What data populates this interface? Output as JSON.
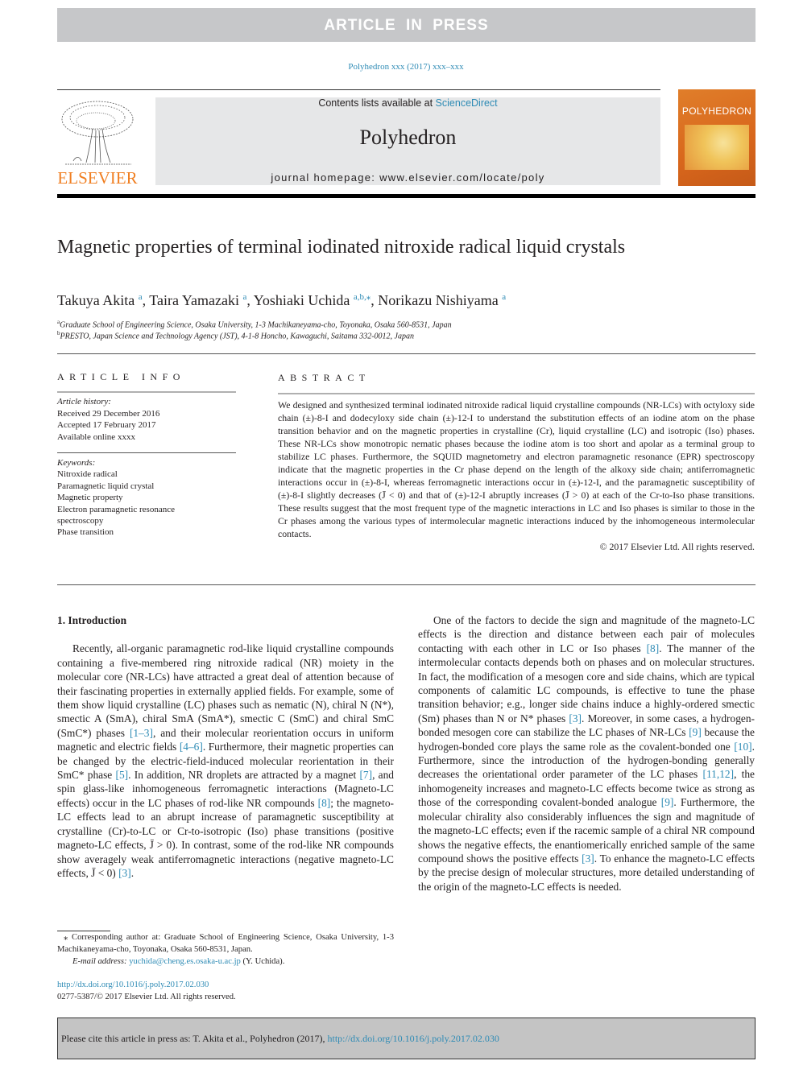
{
  "banner": "ARTICLE IN PRESS",
  "journal_ref": "Polyhedron xxx (2017) xxx–xxx",
  "header": {
    "publisher_logo_text": "ELSEVIER",
    "contents_prefix": "Contents lists available at ",
    "contents_link": "ScienceDirect",
    "journal_name": "Polyhedron",
    "homepage": "journal homepage: www.elsevier.com/locate/poly",
    "cover_title": "POLYHEDRON"
  },
  "article": {
    "title": "Magnetic properties of terminal iodinated nitroxide radical liquid crystals",
    "authors": [
      {
        "name": "Takuya Akita",
        "sup": "a"
      },
      {
        "name": "Taira Yamazaki",
        "sup": "a"
      },
      {
        "name": "Yoshiaki Uchida",
        "sup": "a,b,⁎"
      },
      {
        "name": "Norikazu Nishiyama",
        "sup": "a"
      }
    ],
    "affiliations": [
      {
        "sup": "a",
        "text": "Graduate School of Engineering Science, Osaka University, 1-3 Machikaneyama-cho, Toyonaka, Osaka 560-8531, Japan"
      },
      {
        "sup": "b",
        "text": "PRESTO, Japan Science and Technology Agency (JST), 4-1-8 Honcho, Kawaguchi, Saitama 332-0012, Japan"
      }
    ]
  },
  "article_info": {
    "heading": "ARTICLE INFO",
    "history_label": "Article history:",
    "history": [
      "Received 29 December 2016",
      "Accepted 17 February 2017",
      "Available online xxxx"
    ],
    "keywords_label": "Keywords:",
    "keywords": [
      "Nitroxide radical",
      "Paramagnetic liquid crystal",
      "Magnetic property",
      "Electron paramagnetic resonance",
      "spectroscopy",
      "Phase transition"
    ]
  },
  "abstract": {
    "heading": "ABSTRACT",
    "text": "We designed and synthesized terminal iodinated nitroxide radical liquid crystalline compounds (NR-LCs) with octyloxy side chain (±)-8-I and dodecyloxy side chain (±)-12-I to understand the substitution effects of an iodine atom on the phase transition behavior and on the magnetic properties in crystalline (Cr), liquid crystalline (LC) and isotropic (Iso) phases. These NR-LCs show monotropic nematic phases because the iodine atom is too short and apolar as a terminal group to stabilize LC phases. Furthermore, the SQUID magnetometry and electron paramagnetic resonance (EPR) spectroscopy indicate that the magnetic properties in the Cr phase depend on the length of the alkoxy side chain; antiferromagnetic interactions occur in (±)-8-I, whereas ferromagnetic interactions occur in (±)-12-I, and the paramagnetic susceptibility of (±)-8-I slightly decreases (J̄ < 0) and that of (±)-12-I abruptly increases (J̄ > 0) at each of the Cr-to-Iso phase transitions. These results suggest that the most frequent type of the magnetic interactions in LC and Iso phases is similar to those in the Cr phases among the various types of intermolecular magnetic interactions induced by the inhomogeneous intermolecular contacts.",
    "copyright": "© 2017 Elsevier Ltd. All rights reserved."
  },
  "body": {
    "section_heading": "1. Introduction",
    "left_para": [
      {
        "t": "Recently, all-organic paramagnetic rod-like liquid crystalline compounds containing a five-membered ring nitroxide radical (NR) moiety in the molecular core (NR-LCs) have attracted a great deal of attention because of their fascinating properties in externally applied fields. For example, some of them show liquid crystalline (LC) phases such as nematic (N), chiral N (N*), smectic A (SmA), chiral SmA (SmA*), smectic C (SmC) and chiral SmC (SmC*) phases "
      },
      {
        "ref": "[1–3]"
      },
      {
        "t": ", and their molecular reorientation occurs in uniform magnetic and electric fields "
      },
      {
        "ref": "[4–6]"
      },
      {
        "t": ". Furthermore, their magnetic properties can be changed by the electric-field-induced molecular reorientation in their SmC* phase "
      },
      {
        "ref": "[5]"
      },
      {
        "t": ". In addition, NR droplets are attracted by a magnet "
      },
      {
        "ref": "[7]"
      },
      {
        "t": ", and spin glass-like inhomogeneous ferromagnetic interactions (Magneto-LC effects) occur in the LC phases of rod-like NR compounds "
      },
      {
        "ref": "[8]"
      },
      {
        "t": "; the magneto-LC effects lead to an abrupt increase of paramagnetic susceptibility at crystalline (Cr)-to-LC or Cr-to-isotropic (Iso) phase transitions (positive magneto-LC effects, J̄ > 0). In contrast, some of the rod-like NR compounds show averagely weak antiferromagnetic interactions (negative magneto-LC effects, J̄ < 0) "
      },
      {
        "ref": "[3]"
      },
      {
        "t": "."
      }
    ],
    "right_para": [
      {
        "t": "One of the factors to decide the sign and magnitude of the magneto-LC effects is the direction and distance between each pair of molecules contacting with each other in LC or Iso phases "
      },
      {
        "ref": "[8]"
      },
      {
        "t": ". The manner of the intermolecular contacts depends both on phases and on molecular structures. In fact, the modification of a mesogen core and side chains, which are typical components of calamitic LC compounds, is effective to tune the phase transition behavior; e.g., longer side chains induce a highly-ordered smectic (Sm) phases than N or N* phases "
      },
      {
        "ref": "[3]"
      },
      {
        "t": ". Moreover, in some cases, a hydrogen-bonded mesogen core can stabilize the LC phases of NR-LCs "
      },
      {
        "ref": "[9]"
      },
      {
        "t": " because the hydrogen-bonded core plays the same role as the covalent-bonded one "
      },
      {
        "ref": "[10]"
      },
      {
        "t": ". Furthermore, since the introduction of the hydrogen-bonding generally decreases the orientational order parameter of the LC phases "
      },
      {
        "ref": "[11,12]"
      },
      {
        "t": ", the inhomogeneity increases and magneto-LC effects become twice as strong as those of the corresponding covalent-bonded analogue "
      },
      {
        "ref": "[9]"
      },
      {
        "t": ". Furthermore, the molecular chirality also considerably influences the sign and magnitude of the magneto-LC effects; even if the racemic sample of a chiral NR compound shows the negative effects, the enantiomerically enriched sample of the same compound shows the positive effects "
      },
      {
        "ref": "[3]"
      },
      {
        "t": ". To enhance the magneto-LC effects by the precise design of molecular structures, more detailed understanding of the origin of the magneto-LC effects is needed."
      }
    ]
  },
  "footnote": {
    "corresponding": "⁎ Corresponding author at: Graduate School of Engineering Science, Osaka University, 1-3 Machikaneyama-cho, Toyonaka, Osaka 560-8531, Japan.",
    "email_label": "E-mail address: ",
    "email": "yuchida@cheng.es.osaka-u.ac.jp",
    "email_suffix": " (Y. Uchida).",
    "doi": "http://dx.doi.org/10.1016/j.poly.2017.02.030",
    "issn": "0277-5387/© 2017 Elsevier Ltd. All rights reserved."
  },
  "cite_box": {
    "prefix": "Please cite this article in press as: T. Akita et al., Polyhedron (2017), ",
    "link": "http://dx.doi.org/10.1016/j.poly.2017.02.030"
  },
  "colors": {
    "link": "#2e8bb5",
    "elsevier_orange": "#f07f22",
    "banner_gray": "#c6c7c9",
    "header_gray": "#e6e7e8",
    "cite_gray": "#c4c4c4"
  }
}
